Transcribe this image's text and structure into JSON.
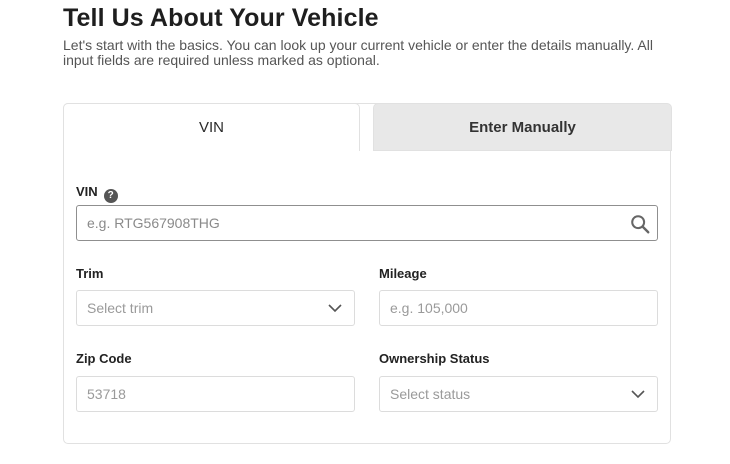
{
  "header": {
    "title": "Tell Us About Your Vehicle",
    "subtitle": "Let's start with the basics. You can look up your current vehicle or enter the details manually. All input fields are required unless marked as optional."
  },
  "tabs": [
    {
      "label": "VIN",
      "active": true
    },
    {
      "label": "Enter Manually",
      "active": false
    }
  ],
  "form": {
    "vin": {
      "label": "VIN",
      "help_icon": "question-circle-icon",
      "help_glyph": "?",
      "placeholder": "e.g. RTG567908THG",
      "icon": "search-icon"
    },
    "trim": {
      "label": "Trim",
      "placeholder": "Select trim",
      "icon": "chevron-down-icon"
    },
    "mileage": {
      "label": "Mileage",
      "placeholder": "e.g. 105,000"
    },
    "zip": {
      "label": "Zip Code",
      "value": "53718"
    },
    "ownership": {
      "label": "Ownership Status",
      "placeholder": "Select status",
      "icon": "chevron-down-icon"
    }
  },
  "colors": {
    "inactive_tab_bg": "#e8e8e8",
    "border": "#dcdcdc",
    "text": "#1e1e1e"
  }
}
